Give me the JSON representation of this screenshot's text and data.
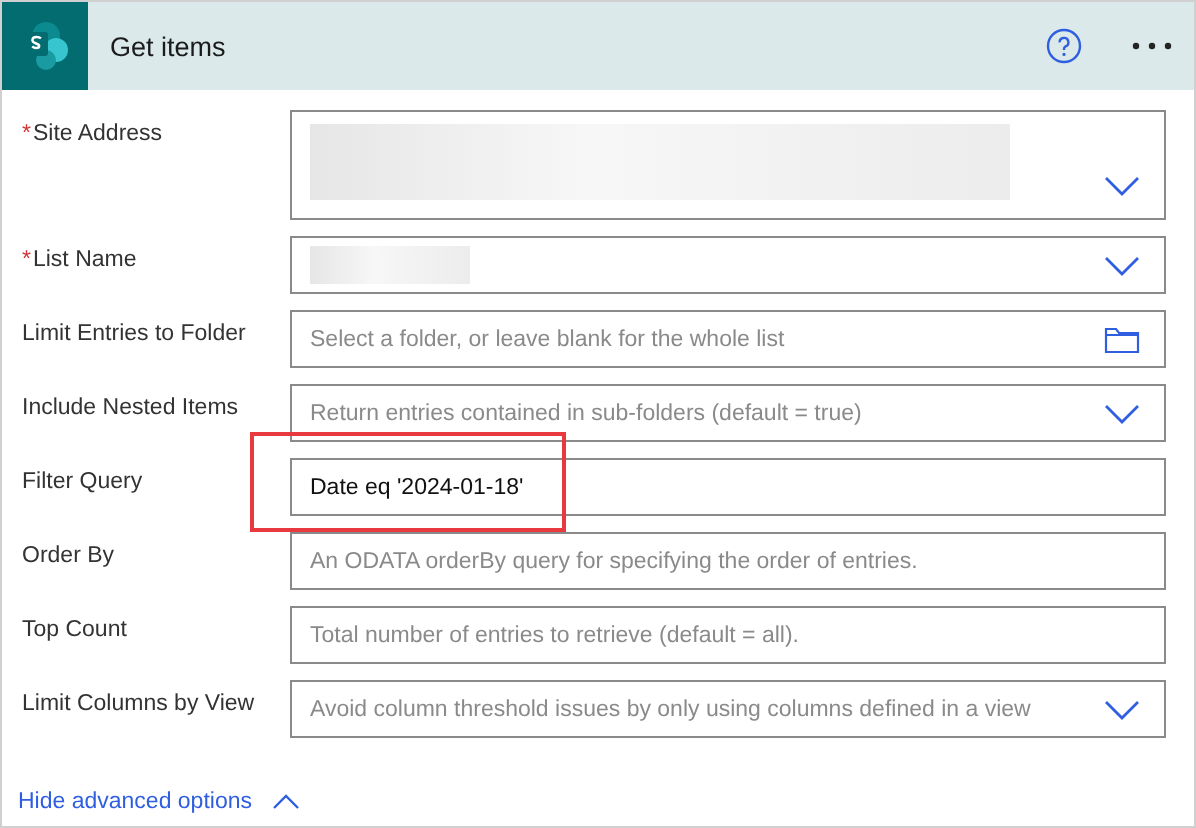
{
  "header": {
    "title": "Get items"
  },
  "fields": [
    {
      "label": "Site Address",
      "required_mark": "*",
      "kind": "dropdown",
      "tall": true,
      "redacted": true
    },
    {
      "label": "List Name",
      "required_mark": "*",
      "kind": "dropdown",
      "tall": false,
      "redacted": true
    },
    {
      "label": "Limit Entries to Folder",
      "kind": "folder",
      "placeholder": "Select a folder, or leave blank for the whole list"
    },
    {
      "label": "Include Nested Items",
      "kind": "dropdown",
      "placeholder": "Return entries contained in sub-folders (default = true)"
    },
    {
      "label": "Filter Query",
      "kind": "text",
      "value": "Date eq '2024-01-18'",
      "highlighted": true
    },
    {
      "label": "Order By",
      "kind": "text",
      "placeholder": "An ODATA orderBy query for specifying the order of entries."
    },
    {
      "label": "Top Count",
      "kind": "text",
      "placeholder": "Total number of entries to retrieve (default = all)."
    },
    {
      "label": "Limit Columns by View",
      "kind": "dropdown",
      "placeholder": "Avoid column threshold issues by only using columns defined in a view"
    }
  ],
  "advanced_toggle": {
    "label": "Hide advanced options",
    "expanded": true
  }
}
